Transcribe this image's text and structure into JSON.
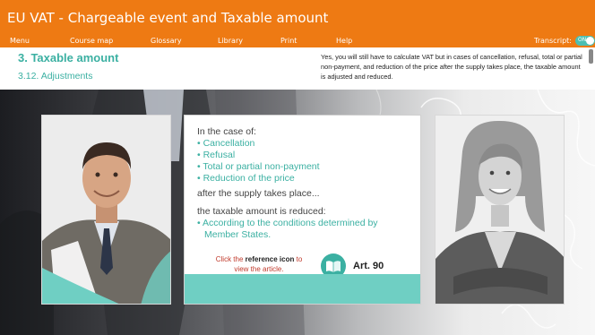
{
  "app": {
    "title": "EU VAT - Chargeable event and Taxable amount"
  },
  "menu": {
    "items": [
      "Menu",
      "Course map",
      "Glossary",
      "Library",
      "Print",
      "Help"
    ],
    "transcript_label": "Transcript:",
    "toggle_label": "ON"
  },
  "header": {
    "section_title": "3. Taxable amount",
    "subsection_title": "3.12. Adjustments",
    "transcript_text": "Yes, you will still have to calculate VAT but in cases of cancellation, refusal, total or partial non-payment, and reduction of the price after the supply takes place, the taxable amount is adjusted and reduced."
  },
  "card": {
    "intro": "In the case of:",
    "cases": [
      "Cancellation",
      "Refusal",
      "Total or partial non-payment",
      "Reduction of the price"
    ],
    "after": "after the supply takes place...",
    "reduced": "the taxable amount is reduced:",
    "conditions_line1": "According to the conditions determined by",
    "conditions_line2": "Member States.",
    "click_prefix": "Click the",
    "click_bold": "reference icon",
    "click_suffix": "to",
    "click_line2": "view the article.",
    "article": "Art. 90"
  },
  "icons": {
    "reference": "book-icon"
  },
  "colors": {
    "orange": "#ee7a13",
    "teal": "#3bb0a2",
    "teal_light": "#6fcfc3"
  }
}
